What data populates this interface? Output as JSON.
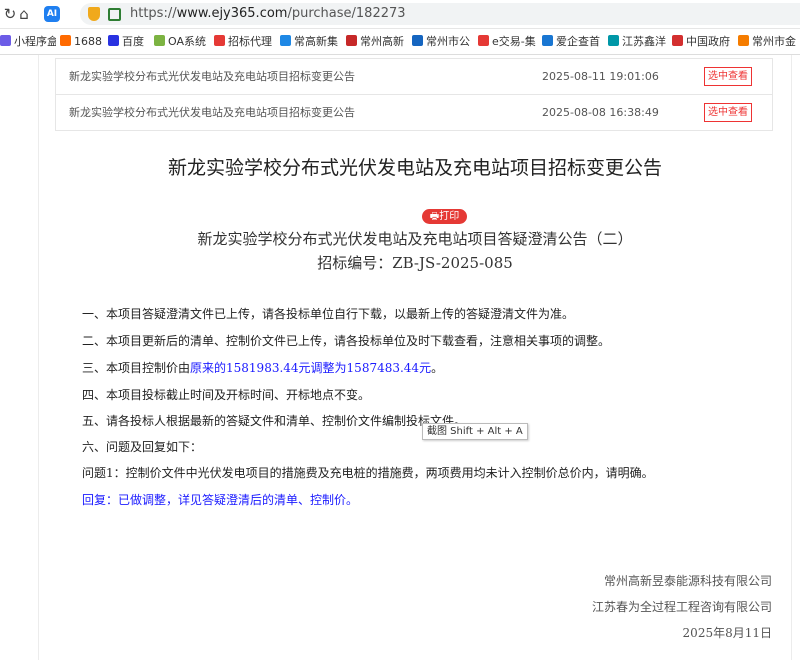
{
  "browser": {
    "url_prefix": "https://",
    "url_host": "www.ejy365.com",
    "url_path": "/purchase/182273",
    "ai_badge": "AI"
  },
  "bookmarks": [
    {
      "label": "小程序盒",
      "color": "#6c5ce7"
    },
    {
      "label": "1688",
      "color": "#ff6a00"
    },
    {
      "label": "百度",
      "color": "#2932e1"
    },
    {
      "label": "OA系统",
      "color": "#7cb342"
    },
    {
      "label": "招标代理",
      "color": "#e53935"
    },
    {
      "label": "常高新集",
      "color": "#1e88e5"
    },
    {
      "label": "常州高新",
      "color": "#c62828"
    },
    {
      "label": "常州市公",
      "color": "#1565c0"
    },
    {
      "label": "e交易-集",
      "color": "#e53935"
    },
    {
      "label": "爱企查首",
      "color": "#1976d2"
    },
    {
      "label": "江苏鑫洋",
      "color": "#0097a7"
    },
    {
      "label": "中国政府",
      "color": "#d32f2f"
    },
    {
      "label": "常州市金",
      "color": "#f57c00"
    }
  ],
  "list": [
    {
      "title": "新龙实验学校分布式光伏发电站及充电站项目招标变更公告",
      "date": "2025-08-11 19:01:06",
      "action": "选中查看"
    },
    {
      "title": "新龙实验学校分布式光伏发电站及充电站项目招标变更公告",
      "date": "2025-08-08 16:38:49",
      "action": "选中查看"
    }
  ],
  "article": {
    "title": "新龙实验学校分布式光伏发电站及充电站项目招标变更公告",
    "print_label": "🖶打印",
    "subtitle": "新龙实验学校分布式光伏发电站及充电站项目答疑澄清公告（二）",
    "code": "招标编号：ZB-JS-2025-085",
    "p1": "一、本项目答疑澄清文件已上传，请各投标单位自行下载，以最新上传的答疑澄清文件为准。",
    "p2": "二、本项目更新后的清单、控制价文件已上传，请各投标单位及时下载查看，注意相关事项的调整。",
    "p3_prefix": "三、本项目控制价由",
    "p3_blue": "原来的1581983.44元调整为1587483.44元",
    "p3_suffix": "。",
    "p4": "四、本项目投标截止时间及开标时间、开标地点不变。",
    "p5": "五、请各投标人根据最新的答疑文件和清单、控制价文件编制投标文件。",
    "p6": "六、问题及回复如下：",
    "q1": "问题1：控制价文件中光伏发电项目的措施费及充电桩的措施费，两项费用均未计入控制价总价内，请明确。",
    "a1": "回复：已做调整，详见答疑澄清后的清单、控制价。",
    "sig1": "常州高新昱泰能源科技有限公司",
    "sig2": "江苏春为全过程工程咨询有限公司",
    "date": "2025年8月11日"
  },
  "tooltip": "截图 Shift + Alt + A"
}
